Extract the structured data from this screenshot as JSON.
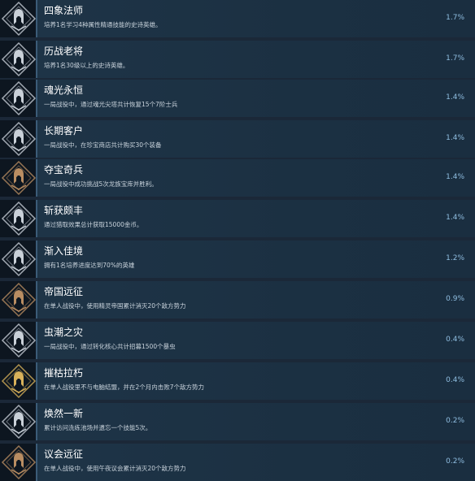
{
  "achievements": [
    {
      "title": "四象法师",
      "desc": "培养1名学习4种属性精通技能的史诗英雄。",
      "pct": "1.7%",
      "icon": "helmet-silver-icon"
    },
    {
      "title": "历战老将",
      "desc": "培养1名30级以上的史诗英雄。",
      "pct": "1.7%",
      "icon": "helmet-silver-icon"
    },
    {
      "title": "魂光永恒",
      "desc": "一局战役中，通过魂光尖塔共计恢复15个7阶士兵",
      "pct": "1.4%",
      "icon": "helmet-silver-icon"
    },
    {
      "title": "长期客户",
      "desc": "一局战役中，在珍宝商店共计购买30个装备",
      "pct": "1.4%",
      "icon": "helmet-silver-icon"
    },
    {
      "title": "夺宝奇兵",
      "desc": "一局战役中成功挑战5次龙族宝库并胜利。",
      "pct": "1.4%",
      "icon": "helmet-bronze-icon"
    },
    {
      "title": "斩获颇丰",
      "desc": "通过猎取效果总计获取15000金币。",
      "pct": "1.4%",
      "icon": "helmet-silver-icon"
    },
    {
      "title": "渐入佳境",
      "desc": "拥有1名培养进度达到70%的英雄",
      "pct": "1.2%",
      "icon": "helmet-silver-icon"
    },
    {
      "title": "帝国远征",
      "desc": "在单人战役中，使用精灵帝国累计消灭20个敌方势力",
      "pct": "0.9%",
      "icon": "helmet-bronze-icon"
    },
    {
      "title": "虫潮之灾",
      "desc": "一局战役中，通过转化核心共计招募1500个暴虫",
      "pct": "0.4%",
      "icon": "helmet-silver-icon"
    },
    {
      "title": "摧枯拉朽",
      "desc": "在单人战役里不与电脑结盟，并在2个月内击败7个敌方势力",
      "pct": "0.4%",
      "icon": "helmet-gold-icon"
    },
    {
      "title": "焕然一新",
      "desc": "累计访问洗练池场并遗忘一个技能5次。",
      "pct": "0.2%",
      "icon": "helmet-silver-icon"
    },
    {
      "title": "议会远征",
      "desc": "在单人战役中，使用午夜议会累计消灭20个敌方势力",
      "pct": "0.2%",
      "icon": "helmet-bronze-icon"
    }
  ],
  "colors": {
    "silver": "#c9d0d8",
    "bronze": "#b98d62",
    "gold": "#d8b15a"
  }
}
